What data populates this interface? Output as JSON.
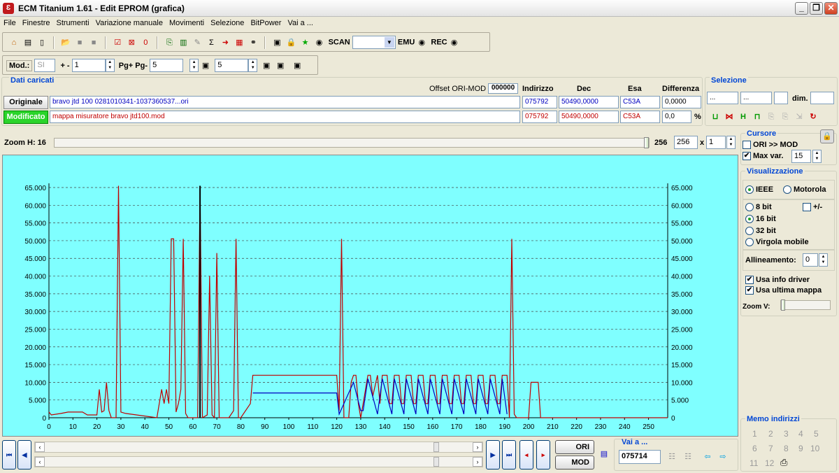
{
  "window": {
    "title": "ECM Titanium 1.61 - Edit EPROM (grafica)",
    "icon": "app-logo-icon"
  },
  "menu": [
    "File",
    "Finestre",
    "Strumenti",
    "Variazione manuale",
    "Movimenti",
    "Selezione",
    "BitPower",
    "Vai a ..."
  ],
  "toolbar": {
    "scan_label": "SCAN",
    "scan_value": "",
    "emu_label": "EMU",
    "rec_label": "REC"
  },
  "toolbar2": {
    "mod_label": "Mod.:",
    "mod_value": "SI",
    "pm_label": "+ -",
    "pm_value": "1",
    "pg_label": "Pg+ Pg-",
    "pg_value": "5",
    "p_value": "5"
  },
  "dati": {
    "title": "Dati caricati",
    "offset_label": "Offset ORI-MOD",
    "offset_value": "000000",
    "headers": {
      "indirizzo": "Indirizzo",
      "dec": "Dec",
      "esa": "Esa",
      "diff": "Differenza"
    },
    "originale": {
      "label": "Originale",
      "file": "bravo jtd 100 0281010341-1037360537...ori",
      "indirizzo": "075792",
      "dec": "50490,0000",
      "esa": "C53A",
      "diff": "0,0000"
    },
    "modificato": {
      "label": "Modificato",
      "file": "mappa misuratore bravo jtd100.mod",
      "indirizzo": "075792",
      "dec": "50490,0000",
      "esa": "C53A",
      "diff": "0,0",
      "pct": "%"
    }
  },
  "selezione": {
    "title": "Selezione",
    "f1": "...",
    "f2": "...",
    "dim_label": "dim."
  },
  "zoom": {
    "label": "Zoom H: 16",
    "value": "256",
    "box": "256",
    "mult_label": "x",
    "mult": "1"
  },
  "cursore": {
    "title": "Cursore",
    "ori_mod": "ORI >> MOD",
    "maxvar_label": "Max var.",
    "maxvar_value": "15"
  },
  "visualizzazione": {
    "title": "Visualizzazione",
    "ieee": "IEEE",
    "motorola": "Motorola",
    "b8": "8 bit",
    "pm": "+/-",
    "b16": "16 bit",
    "b32": "32 bit",
    "float": "Virgola mobile",
    "allineamento_label": "Allineamento:",
    "allineamento_value": "0",
    "usa_info": "Usa info driver",
    "usa_ultima": "Usa ultima mappa",
    "zoomv_label": "Zoom V:"
  },
  "memo": {
    "title": "Memo indirizzi",
    "nums": [
      "1",
      "2",
      "3",
      "4",
      "5",
      "6",
      "7",
      "8",
      "9",
      "10",
      "11",
      "12"
    ]
  },
  "bottom": {
    "ori_label": "ORI",
    "mod_label": "MOD",
    "vai_label": "Vai a ...",
    "vai_value": "075714"
  },
  "colors": {
    "plot_bg": "#7fffff",
    "series_ori": "#c00000",
    "series_mod": "#0000c0",
    "cursor": "#000000"
  },
  "chart_data": {
    "type": "line",
    "title": "",
    "xlabel": "",
    "ylabel": "",
    "xlim": [
      0,
      258
    ],
    "ylim": [
      0,
      65000
    ],
    "grid": true,
    "x_ticks": [
      "0",
      "10",
      "20",
      "30",
      "40",
      "50",
      "60",
      "70",
      "80",
      "90",
      "100",
      "110",
      "120",
      "130",
      "140",
      "150",
      "160",
      "170",
      "180",
      "190",
      "200",
      "210",
      "220",
      "230",
      "240",
      "250"
    ],
    "y_ticks_left": [
      "65.000",
      "60.000",
      "55.000",
      "50.000",
      "45.000",
      "40.000",
      "35.000",
      "30.000",
      "25.000",
      "20.000",
      "15.000",
      "10.000",
      "5.000",
      "0"
    ],
    "y_ticks_right": [
      "65.000",
      "60.000",
      "55.000",
      "50.000",
      "45.000",
      "40.000",
      "35.000",
      "30.000",
      "25.000",
      "20.000",
      "15.000",
      "10.000",
      "5.000",
      "0"
    ],
    "cursor_x": 63,
    "series": [
      {
        "values": [
          [
            0,
            1600
          ],
          [
            1,
            800
          ],
          [
            5,
            1200
          ],
          [
            8,
            1600
          ],
          [
            14,
            1600
          ],
          [
            16,
            800
          ],
          [
            20,
            800
          ],
          [
            21,
            8000
          ],
          [
            22,
            1600
          ],
          [
            23,
            2000
          ],
          [
            24,
            10000
          ],
          [
            25,
            2000
          ],
          [
            26,
            0
          ],
          [
            28,
            0
          ],
          [
            29,
            65500
          ],
          [
            30,
            1600
          ],
          [
            32,
            1200
          ],
          [
            45,
            0
          ],
          [
            47,
            8000
          ],
          [
            48,
            4000
          ],
          [
            49,
            8000
          ],
          [
            50,
            4000
          ],
          [
            51,
            50490
          ],
          [
            52,
            50490
          ],
          [
            53,
            1600
          ],
          [
            54,
            4000
          ],
          [
            55,
            8000
          ],
          [
            56,
            50490
          ],
          [
            57,
            1200
          ],
          [
            58,
            0
          ],
          [
            62,
            0
          ],
          [
            63,
            65500
          ],
          [
            64,
            0
          ],
          [
            66,
            800
          ],
          [
            67,
            40000
          ],
          [
            68,
            800
          ],
          [
            69,
            0
          ],
          [
            70,
            46500
          ],
          [
            71,
            0
          ],
          [
            75,
            0
          ],
          [
            77,
            2000
          ],
          [
            78,
            50490
          ],
          [
            79,
            0
          ],
          [
            80,
            0
          ],
          [
            84,
            4000
          ],
          [
            85,
            12000
          ],
          [
            120,
            12000
          ],
          [
            121,
            2000
          ],
          [
            122,
            50490
          ],
          [
            123,
            0
          ],
          [
            125,
            0
          ],
          [
            126,
            10000
          ],
          [
            127,
            12000
          ],
          [
            128,
            12000
          ],
          [
            129,
            4000
          ],
          [
            130,
            0
          ],
          [
            131,
            4000
          ],
          [
            133,
            12000
          ],
          [
            134,
            12000
          ],
          [
            135,
            6000
          ],
          [
            137,
            12000
          ],
          [
            138,
            4000
          ],
          [
            139,
            12000
          ],
          [
            141,
            12000
          ],
          [
            142,
            4000
          ],
          [
            143,
            4000
          ],
          [
            144,
            12000
          ],
          [
            146,
            12000
          ],
          [
            147,
            4000
          ],
          [
            148,
            4000
          ],
          [
            149,
            12000
          ],
          [
            151,
            12000
          ],
          [
            152,
            4000
          ],
          [
            153,
            4000
          ],
          [
            154,
            12000
          ],
          [
            156,
            12000
          ],
          [
            157,
            4000
          ],
          [
            158,
            4000
          ],
          [
            159,
            12000
          ],
          [
            161,
            12000
          ],
          [
            162,
            4000
          ],
          [
            163,
            4000
          ],
          [
            164,
            12000
          ],
          [
            166,
            12000
          ],
          [
            167,
            4000
          ],
          [
            168,
            4000
          ],
          [
            169,
            12000
          ],
          [
            171,
            12000
          ],
          [
            172,
            4000
          ],
          [
            173,
            4000
          ],
          [
            174,
            12000
          ],
          [
            176,
            12000
          ],
          [
            177,
            4000
          ],
          [
            178,
            4000
          ],
          [
            179,
            12000
          ],
          [
            181,
            12000
          ],
          [
            182,
            4000
          ],
          [
            183,
            4000
          ],
          [
            184,
            12000
          ],
          [
            186,
            12000
          ],
          [
            187,
            4000
          ],
          [
            188,
            4000
          ],
          [
            189,
            12000
          ],
          [
            191,
            12000
          ],
          [
            192,
            0
          ],
          [
            193,
            50490
          ],
          [
            194,
            1000
          ],
          [
            195,
            0
          ],
          [
            200,
            0
          ],
          [
            201,
            10000
          ],
          [
            204,
            10000
          ],
          [
            205,
            0
          ],
          [
            258,
            0
          ]
        ]
      },
      {
        "values": [
          [
            85,
            7000
          ],
          [
            120,
            7000
          ],
          [
            121,
            1000
          ],
          [
            127,
            10000
          ],
          [
            130,
            2000
          ],
          [
            131,
            2000
          ],
          [
            133,
            11000
          ],
          [
            137,
            1000
          ],
          [
            139,
            11000
          ],
          [
            143,
            1000
          ],
          [
            144,
            11000
          ],
          [
            148,
            1000
          ],
          [
            149,
            11000
          ],
          [
            153,
            1000
          ],
          [
            154,
            11000
          ],
          [
            158,
            1000
          ],
          [
            159,
            11000
          ],
          [
            163,
            1000
          ],
          [
            164,
            11000
          ],
          [
            168,
            1000
          ],
          [
            169,
            11000
          ],
          [
            173,
            1000
          ],
          [
            174,
            11000
          ],
          [
            178,
            1000
          ],
          [
            179,
            11000
          ],
          [
            183,
            1000
          ],
          [
            184,
            11000
          ],
          [
            188,
            1000
          ],
          [
            189,
            11000
          ],
          [
            191,
            1000
          ]
        ]
      }
    ]
  }
}
